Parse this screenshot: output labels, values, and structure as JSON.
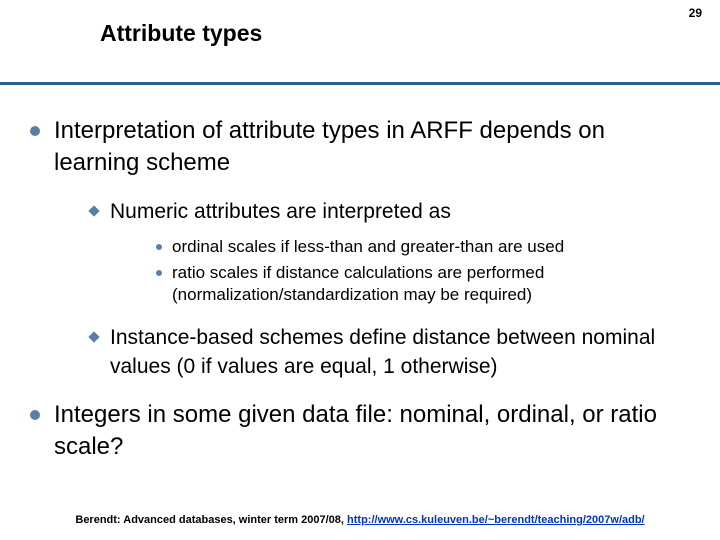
{
  "page_number": "29",
  "title": "Attribute types",
  "bullets": {
    "b1": "Interpretation of attribute types in ARFF depends on learning scheme",
    "b1_1": "Numeric attributes are interpreted as",
    "b1_1_1": "ordinal scales if less-than and greater-than are used",
    "b1_1_2": "ratio scales if distance calculations are performed (normalization/standardization may be required)",
    "b1_2": "Instance-based schemes define distance between nominal values (0 if values are equal, 1 otherwise)",
    "b2": "Integers in some given data file: nominal, ordinal, or ratio scale?"
  },
  "footer": {
    "prefix": "Berendt: Advanced databases, winter term 2007/08, ",
    "link_text": "http://www.cs.kuleuven.be/~berendt/teaching/2007w/adb/"
  }
}
